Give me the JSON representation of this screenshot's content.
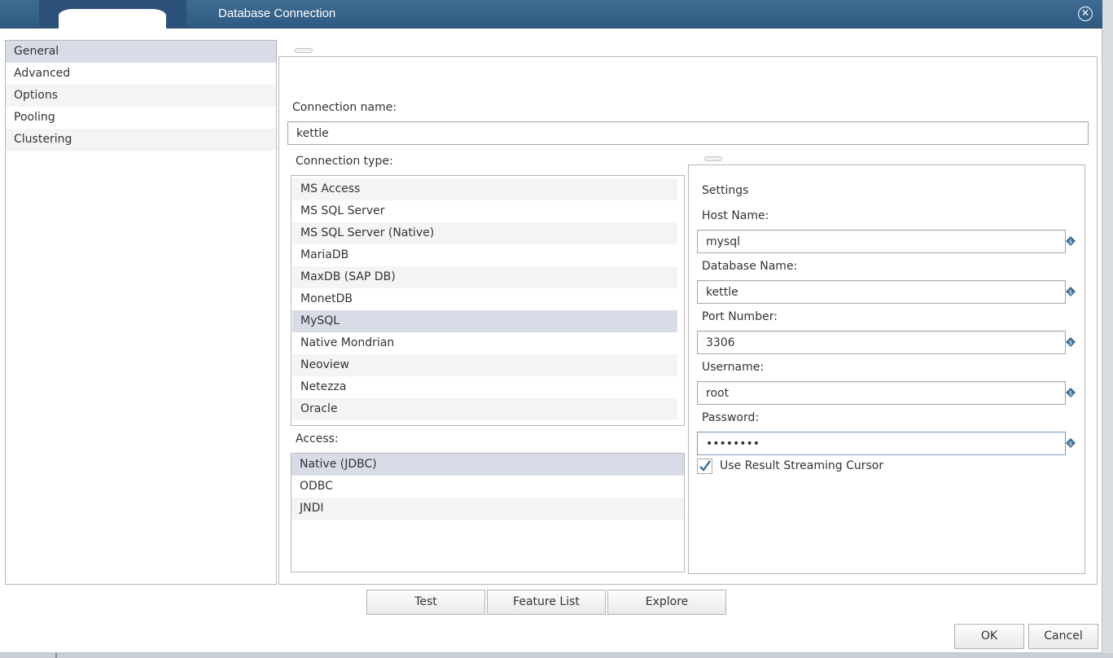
{
  "window": {
    "title": "Database Connection"
  },
  "sidebar": {
    "items": [
      {
        "label": "General"
      },
      {
        "label": "Advanced"
      },
      {
        "label": "Options"
      },
      {
        "label": "Pooling"
      },
      {
        "label": "Clustering"
      }
    ]
  },
  "general": {
    "connection_name_label": "Connection name:",
    "connection_name_value": "kettle",
    "connection_type_label": "Connection type:",
    "connection_types": [
      "MS Access",
      "MS SQL Server",
      "MS SQL Server (Native)",
      "MariaDB",
      "MaxDB (SAP DB)",
      "MonetDB",
      "MySQL",
      "Native Mondrian",
      "Neoview",
      "Netezza",
      "Oracle"
    ],
    "selected_connection_type": "MySQL",
    "access_label": "Access:",
    "access_types": [
      "Native (JDBC)",
      "ODBC",
      "JNDI"
    ],
    "selected_access": "Native (JDBC)"
  },
  "settings": {
    "heading": "Settings",
    "host_name_label": "Host Name:",
    "host_name_value": "mysql",
    "database_name_label": "Database Name:",
    "database_name_value": "kettle",
    "port_number_label": "Port Number:",
    "port_number_value": "3306",
    "username_label": "Username:",
    "username_value": "root",
    "password_label": "Password:",
    "password_value": "••••••••",
    "streaming_cursor_label": "Use Result Streaming Cursor",
    "streaming_cursor_checked": true
  },
  "actions": {
    "test": "Test",
    "feature_list": "Feature List",
    "explore": "Explore",
    "ok": "OK",
    "cancel": "Cancel"
  },
  "colors": {
    "titlebar": "#2f5a82",
    "selection": "#d8dce6",
    "variable_icon": "#3c6f96"
  }
}
